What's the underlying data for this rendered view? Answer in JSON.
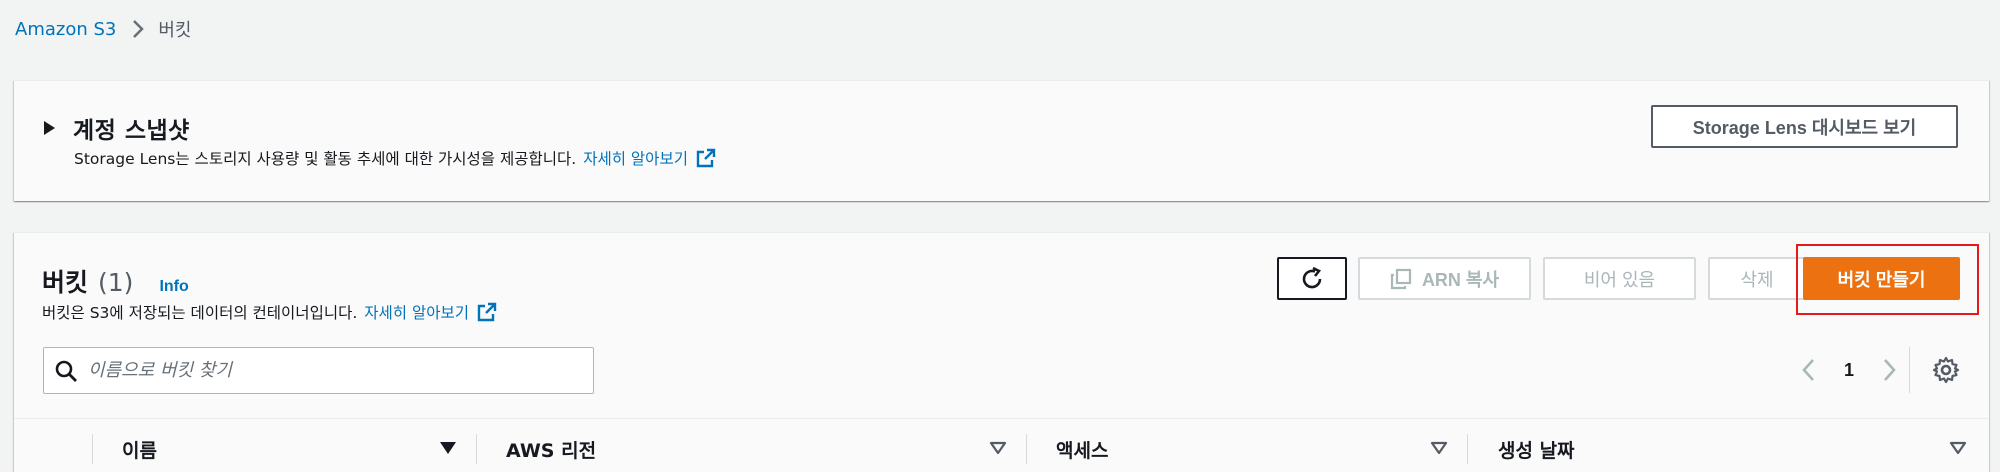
{
  "breadcrumb": {
    "root": "Amazon S3",
    "current": "버킷"
  },
  "snapshot": {
    "title": "계정 스냅샷",
    "description": "Storage Lens는 스토리지 사용량 및 활동 추세에 대한 가시성을 제공합니다.",
    "learn_more": "자세히 알아보기",
    "lens_button": "Storage Lens 대시보드 보기"
  },
  "buckets": {
    "title": "버킷",
    "count": "(1)",
    "info": "Info",
    "description": "버킷은 S3에 저장되는 데이터의 컨테이너입니다.",
    "learn_more": "자세히 알아보기",
    "actions": {
      "copy_arn": "ARN 복사",
      "empty": "비어 있음",
      "delete": "삭제",
      "create": "버킷 만들기"
    },
    "search": {
      "placeholder": "이름으로 버킷 찾기",
      "value": ""
    },
    "pagination": {
      "page": "1"
    },
    "columns": [
      "이름",
      "AWS 리전",
      "액세스",
      "생성 날짜"
    ]
  },
  "colors": {
    "link": "#0073bb",
    "primary": "#ec7211",
    "highlight": "#e01c1c",
    "disabled": "#aab7b8"
  },
  "icons": [
    "chevron-right-icon",
    "caret-right-icon",
    "external-link-icon",
    "refresh-icon",
    "copy-icon",
    "search-icon",
    "chevron-left-icon",
    "settings-icon",
    "sort-down-icon"
  ]
}
